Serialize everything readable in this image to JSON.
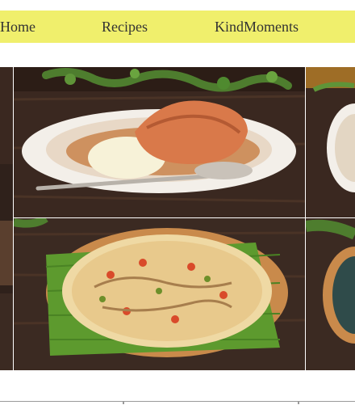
{
  "nav": {
    "items": [
      {
        "label": "Home"
      },
      {
        "label": "Recipes"
      },
      {
        "label": "KindMoments"
      }
    ]
  },
  "gallery": {
    "images": [
      {
        "depicts": "dumpling-dessert-with-ice-cream-photo"
      },
      {
        "depicts": "pizza-on-banana-leaf-photo"
      }
    ]
  },
  "colors": {
    "nav_bg": "#f0ef6c",
    "wood": "#3b2a22",
    "plate": "#f3efe9"
  }
}
